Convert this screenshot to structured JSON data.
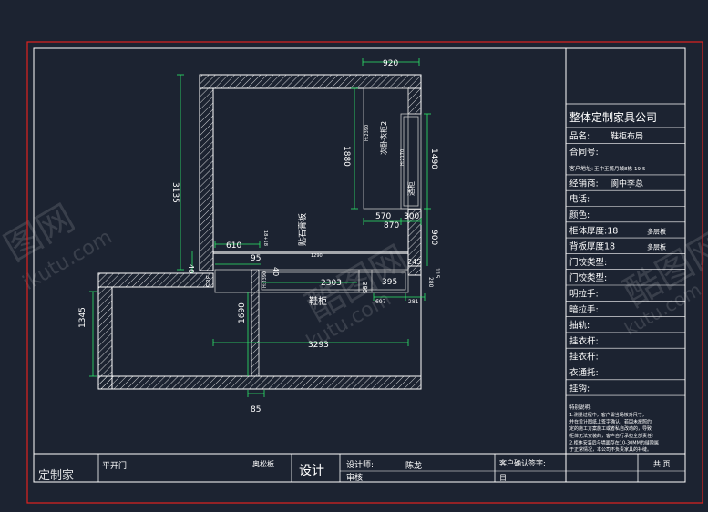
{
  "colors": {
    "background": "#1c2331",
    "frame": "#ffffff",
    "outer_frame": "#e0221e",
    "dimension": "#2ee86a",
    "wall": "#ffffff",
    "text": "#ffffff",
    "cabinet": "#c8c8c8"
  },
  "drawing": {
    "dimensions": {
      "top_width": "920",
      "left_height": "3135",
      "wardrobe_height": "1880",
      "cabinet_h": "H:2390",
      "wardrobe_label": "次卧衣柜2",
      "right_height": "1490",
      "tall_cab_h": "H:2170",
      "tall_cab_label": "酒柜",
      "w570": "570",
      "w300": "300",
      "w870": "870",
      "w900": "900",
      "w610": "610",
      "small_label": "18+18",
      "tile_label": "贴石膏板",
      "w95": "95",
      "w40a": "40",
      "w40b": "40",
      "w385": "385",
      "w245": "245",
      "w115": "115",
      "w280": "280",
      "w2303": "2303",
      "shoe_h": "H:2390",
      "w395": "395",
      "w395b": "395",
      "w697": "697",
      "w281": "281",
      "shoe_label": "鞋柜",
      "small_1290": "1290",
      "w1345": "1345",
      "w1690": "1690",
      "w3293": "3293",
      "w85": "85"
    }
  },
  "title_block": {
    "company": "整体定制家具公司",
    "rows": [
      {
        "label": "品名:",
        "value": "鞋柜布局"
      },
      {
        "label": "合同号:",
        "value": ""
      },
      {
        "label": "客户地址:",
        "value": "王中王揽月城8栋-19-5"
      },
      {
        "label": "经销商:",
        "value": "阆中李总"
      },
      {
        "label": "电话:",
        "value": ""
      },
      {
        "label": "颜色:",
        "value": ""
      },
      {
        "label": "柜体厚度:18",
        "value": "多层板"
      },
      {
        "label": "背板厚度18",
        "value": "多层板"
      },
      {
        "label": "门饺类型:",
        "value": ""
      },
      {
        "label": "门饺类型:",
        "value": ""
      },
      {
        "label": "明拉手:",
        "value": ""
      },
      {
        "label": "暗拉手:",
        "value": ""
      },
      {
        "label": "抽轨:",
        "value": ""
      },
      {
        "label": "挂衣杆:",
        "value": ""
      },
      {
        "label": "挂衣杆:",
        "value": ""
      },
      {
        "label": "衣通托:",
        "value": ""
      },
      {
        "label": "挂钩:",
        "value": ""
      }
    ],
    "notes_title": "特别说明:",
    "notes": [
      "1.测量过程中，客户需当场核对尺寸，",
      "并在设计图纸上签字确认，若因未按照约",
      "定的施工方案施工或者私自改动的，导致",
      "柜体无法安装的，客户自行承担全部责任!",
      "2.柜体安装后与墙面存在10-30MM的缝隙属",
      "于正常情况，本公司不负责家具的补缝。"
    ]
  },
  "bottom_bar": {
    "logo_text": "定制家",
    "open_door_label": "平开门:",
    "material": "奥松板",
    "design_label": "设计",
    "designer_label": "设计师:",
    "designer_name": "陈龙",
    "review_label": "审核:",
    "customer_confirm": "客户确认签字:",
    "date_label": "日",
    "sheet_label": "共 页"
  },
  "watermarks": [
    "图网",
    "ikutu.com",
    "酷图网",
    "kutu.com",
    "K"
  ]
}
